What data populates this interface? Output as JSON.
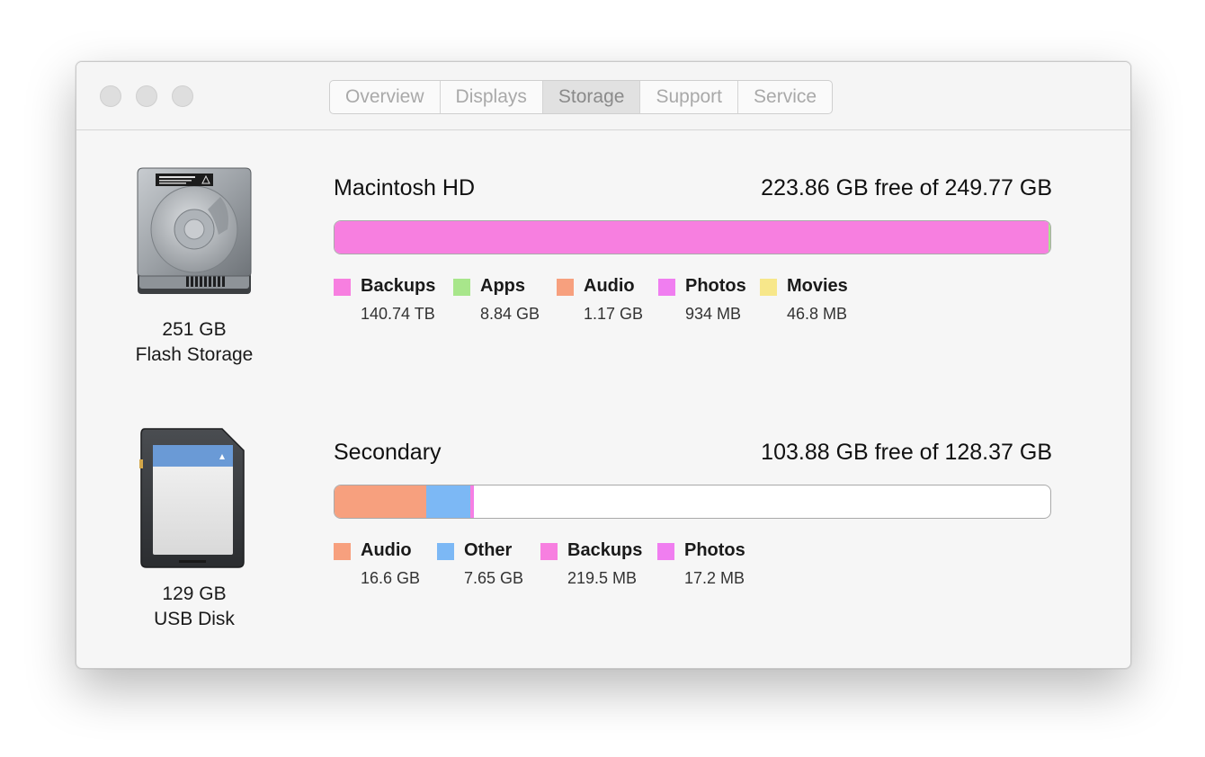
{
  "window": {
    "tabs": [
      {
        "label": "Overview",
        "active": false
      },
      {
        "label": "Displays",
        "active": false
      },
      {
        "label": "Storage",
        "active": true
      },
      {
        "label": "Support",
        "active": false
      },
      {
        "label": "Service",
        "active": false
      }
    ]
  },
  "devices": [
    {
      "icon": "hard-drive-icon",
      "capacity": "251 GB",
      "type": "Flash Storage",
      "volume_name": "Macintosh HD",
      "free_text": "223.86 GB free of 249.77 GB",
      "usage_bar": [
        {
          "category": "Backups",
          "color": "#f77fe0",
          "fraction": 0.997
        },
        {
          "category": "Apps",
          "color": "#a8e68b",
          "fraction": 0.003
        }
      ],
      "legend": [
        {
          "label": "Backups",
          "value": "140.74 TB",
          "color": "#f77fe0"
        },
        {
          "label": "Apps",
          "value": "8.84 GB",
          "color": "#a8e68b"
        },
        {
          "label": "Audio",
          "value": "1.17 GB",
          "color": "#f7a07e"
        },
        {
          "label": "Photos",
          "value": "934 MB",
          "color": "#f07ef0"
        },
        {
          "label": "Movies",
          "value": "46.8 MB",
          "color": "#f7e78a"
        }
      ]
    },
    {
      "icon": "sd-card-icon",
      "capacity": "129 GB",
      "type": "USB Disk",
      "volume_name": "Secondary",
      "free_text": "103.88 GB free of 128.37 GB",
      "usage_bar": [
        {
          "category": "Audio",
          "color": "#f7a07e",
          "fraction": 0.128
        },
        {
          "category": "Other",
          "color": "#7cb8f5",
          "fraction": 0.062
        },
        {
          "category": "Backups",
          "color": "#f77fe0",
          "fraction": 0.003
        },
        {
          "category": "Photos",
          "color": "#f07ef0",
          "fraction": 0.001
        }
      ],
      "legend": [
        {
          "label": "Audio",
          "value": "16.6 GB",
          "color": "#f7a07e"
        },
        {
          "label": "Other",
          "value": "7.65 GB",
          "color": "#7cb8f5"
        },
        {
          "label": "Backups",
          "value": "219.5 MB",
          "color": "#f77fe0"
        },
        {
          "label": "Photos",
          "value": "17.2 MB",
          "color": "#f07ef0"
        }
      ]
    }
  ]
}
